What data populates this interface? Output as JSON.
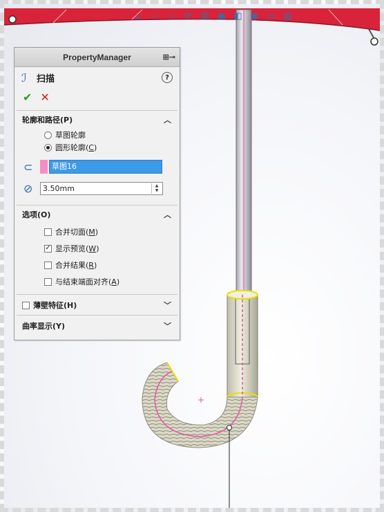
{
  "property_manager": {
    "title": "PropertyManager",
    "feature": {
      "name": "扫描",
      "icon": "sweep-icon"
    },
    "actions": {
      "ok_icon": "✔",
      "cancel_icon": "✕"
    },
    "profile_path": {
      "title": "轮廓和路径(P)",
      "radio_sketch": {
        "label": "草图轮廓",
        "selected": false
      },
      "radio_circle": {
        "label": "圆形轮廓",
        "accel": "C",
        "selected": true
      },
      "path_field": {
        "value": "草图16"
      },
      "diameter": {
        "value": "3.50mm"
      }
    },
    "options": {
      "title": "选项(O)",
      "merge_tangent": {
        "label": "合并切面",
        "accel": "M",
        "checked": false
      },
      "show_preview": {
        "label": "显示预览",
        "accel": "W",
        "checked": true
      },
      "merge_result": {
        "label": "合并结果",
        "accel": "R",
        "checked": false
      },
      "align_end": {
        "label": "与结束端面对齐",
        "accel": "A",
        "checked": false
      }
    },
    "thin_feature": {
      "label": "薄壁特征(H)",
      "checked": false
    },
    "curvature": {
      "label": "曲率显示(Y)"
    }
  },
  "colors": {
    "accent_blue": "#3c9ae8",
    "pink_swatch": "#f58ec5",
    "annotation_red": "#e0202a"
  }
}
